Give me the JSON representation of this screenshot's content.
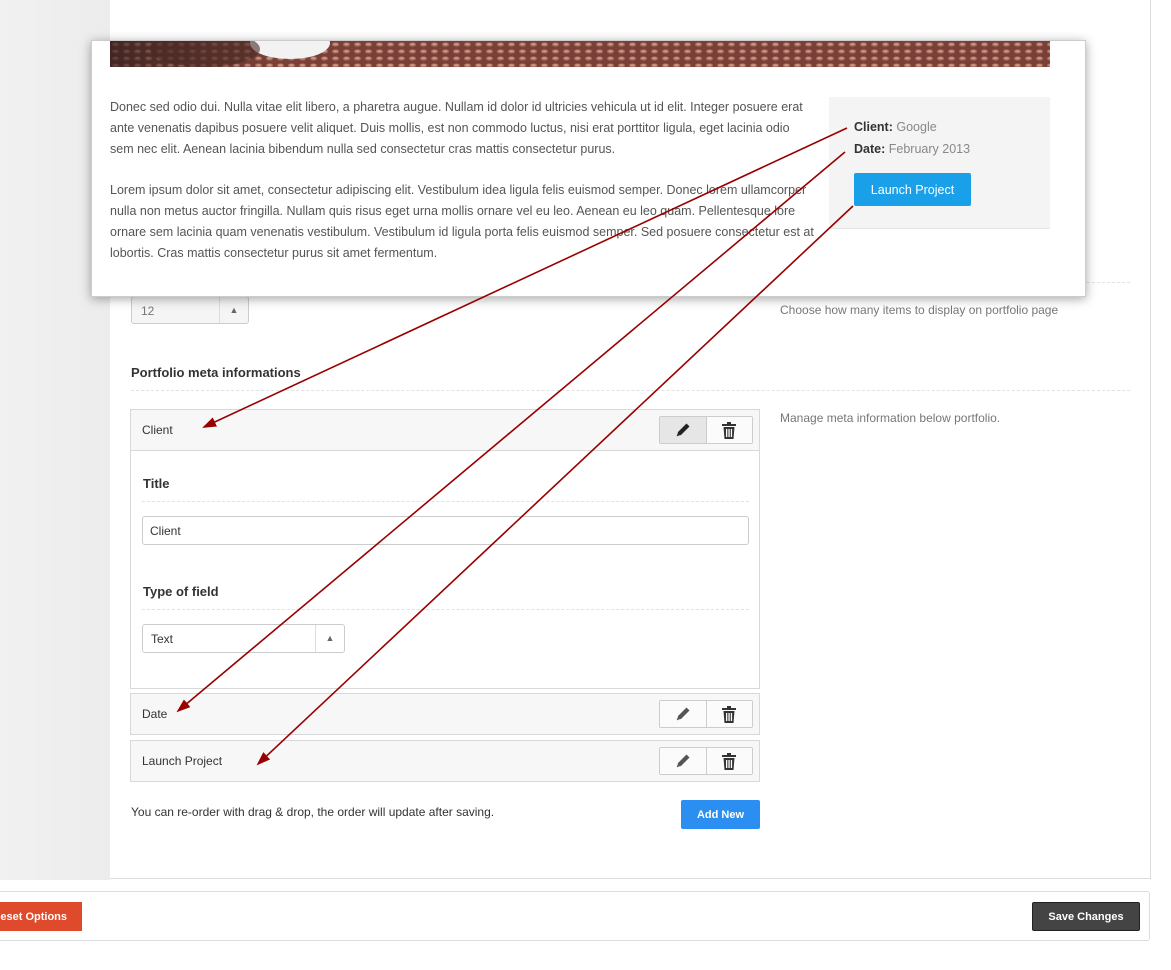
{
  "settings": {
    "items_select_value": "12",
    "items_description": "Choose how many items to display on portfolio page",
    "section_title": "Portfolio meta informations",
    "section_description": "Manage meta information below portfolio.",
    "rows": [
      {
        "label": "Client"
      },
      {
        "label": "Date"
      },
      {
        "label": "Launch Project"
      }
    ],
    "editor": {
      "title_label": "Title",
      "title_value": "Client",
      "type_label": "Type of field",
      "type_value": "Text"
    },
    "hint": "You can re-order with drag & drop, the order will update after saving.",
    "add_new": "Add New"
  },
  "footer": {
    "reset_label": "eset Options",
    "save_label": "Save Changes"
  },
  "preview": {
    "paragraph_1": "Donec sed odio dui. Nulla vitae elit libero, a pharetra augue. Nullam id dolor id ultricies vehicula ut id elit. Integer posuere erat ante venenatis dapibus posuere velit aliquet. Duis mollis, est non commodo luctus, nisi erat porttitor ligula, eget lacinia odio sem nec elit. Aenean lacinia bibendum nulla sed consectetur cras mattis consectetur purus.",
    "paragraph_2": "Lorem ipsum dolor sit amet, consectetur adipiscing elit. Vestibulum idea ligula felis euismod semper. Donec lorem ullamcorper nulla non metus auctor fringilla. Nullam quis risus eget urna mollis ornare vel eu leo. Aenean eu leo quam. Pellentesque lore ornare sem lacinia quam venenatis vestibulum. Vestibulum id ligula porta felis euismod semper. Sed posuere consectetur est at lobortis. Cras mattis consectetur purus sit amet fermentum.",
    "client_key": "Client:",
    "client_value": "Google",
    "date_key": "Date:",
    "date_value": "February 2013",
    "launch_label": "Launch Project"
  },
  "colors": {
    "add_new": "#2a8ff0",
    "reset": "#de4a2b",
    "save": "#444444",
    "launch": "#1aa0e8",
    "arrow": "#990000"
  }
}
